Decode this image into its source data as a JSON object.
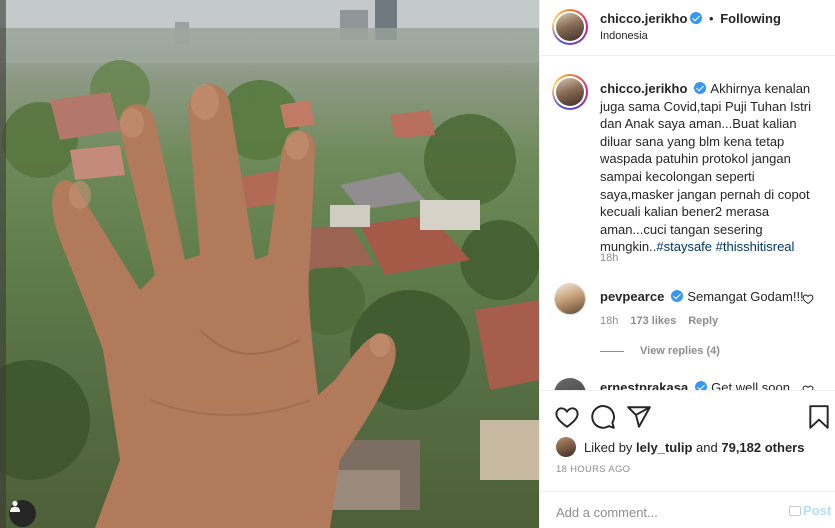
{
  "post": {
    "username": "chicco.jerikho",
    "dot": "•",
    "follow_status": "Following",
    "location": "Indonesia"
  },
  "caption": {
    "username": "chicco.jerikho",
    "text": "Akhirnya kenalan juga sama Covid,tapi Puji Tuhan Istri dan Anak saya aman...Buat kalian diluar sana yang blm kena tetap waspada patuhin protokol jangan sampai kecolongan seperti saya,masker jangan pernah di copot kecuali kalian bener2 merasa aman...cuci tangan sesering mungkin..",
    "hashtag1": "#staysafe",
    "hashtag2": "#thisshitisreal",
    "time": "18h"
  },
  "comments": [
    {
      "username": "pevpearce",
      "text": "Semangat Godam!!!",
      "time": "18h",
      "likes": "173 likes",
      "reply": "Reply",
      "view_replies": "View replies (4)"
    },
    {
      "username": "ernestprakasa",
      "text": "Get well soon"
    }
  ],
  "engagement": {
    "liked_by_prefix": "Liked by",
    "liked_by_user": "lely_tulip",
    "and": "and",
    "others": "79,182 others",
    "timestamp": "18 HOURS AGO"
  },
  "add_comment": {
    "placeholder": "Add a comment...",
    "post_label": "Post"
  },
  "icons": {
    "like": "heart-icon",
    "comment": "comment-icon",
    "share": "share-icon",
    "save": "bookmark-icon",
    "verified": "verified-badge-icon",
    "user": "user-tag-icon"
  },
  "colors": {
    "link": "#00376b",
    "verified": "#3897f0",
    "muted": "#8e8e8e",
    "post_disabled": "#b2dffc"
  }
}
